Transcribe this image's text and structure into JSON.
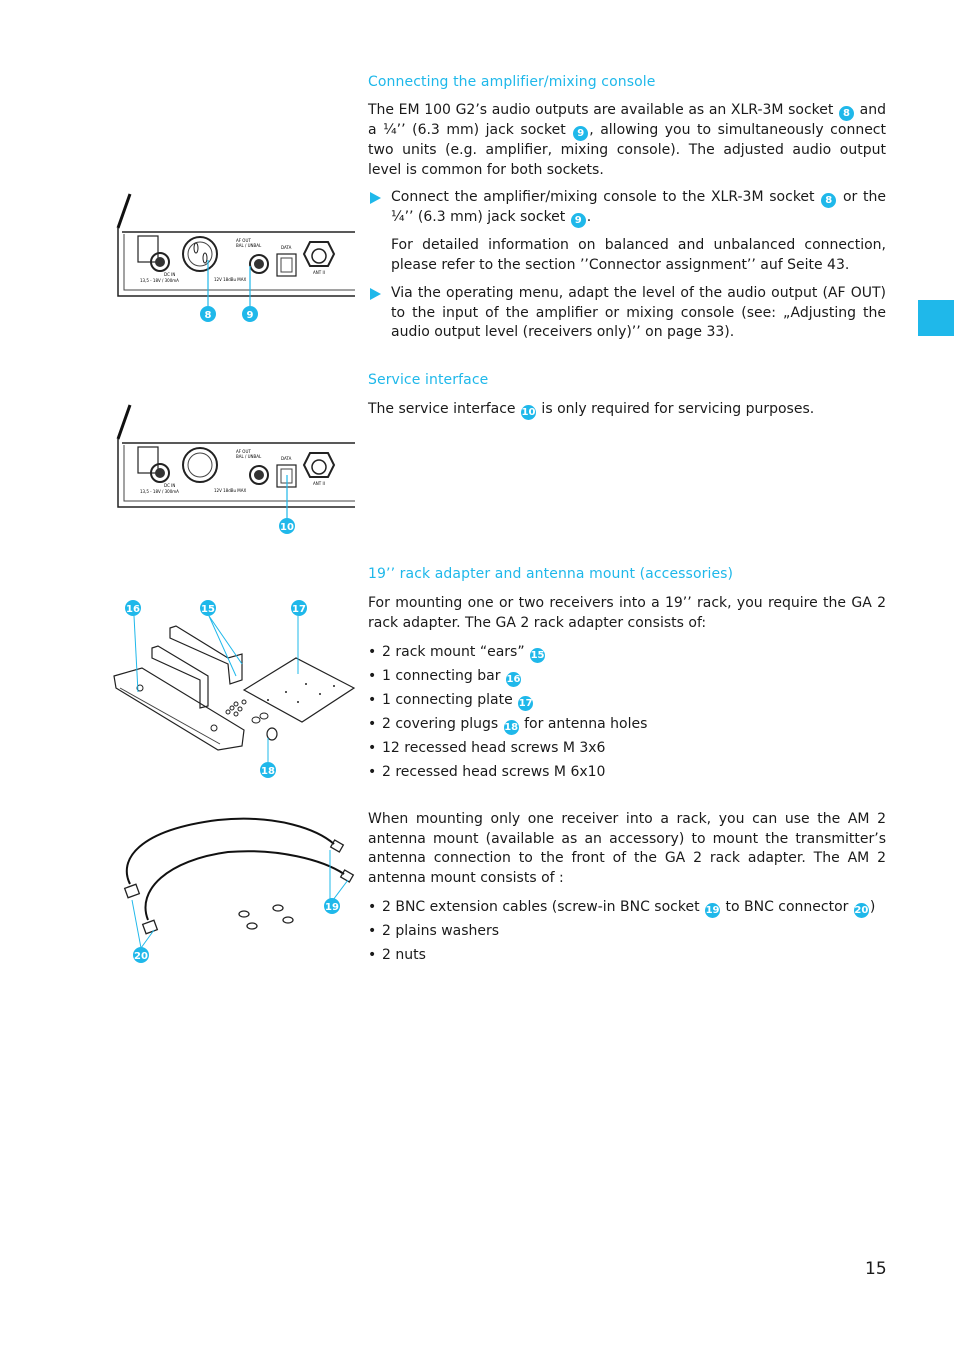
{
  "sections": {
    "amplifier": {
      "heading": "Connecting the amplifier/mixing console",
      "intro_parts": [
        "The EM 100 G2’s audio outputs are available as an XLR-3M socket ",
        "8",
        " and a ¼’’ (6.3 mm) jack socket ",
        "9",
        ", allowing you to simultaneously connect two units (e.g. amplifier, mixing console). The adjusted audio output level is common for both sockets."
      ],
      "step1_parts": [
        "Connect the amplifier/mixing console to the XLR-3M socket ",
        "8",
        " or the ¼’’ (6.3 mm) jack socket ",
        "9",
        "."
      ],
      "step1_note": "For detailed information on balanced and unbalanced connection, please refer to the section ’’Connector assignment’’ auf Seite 43.",
      "step2": "Via the operating menu, adapt the level of the audio output (AF OUT) to the input of the amplifier or mixing console (see: „Adjusting the audio output level (receivers only)’’ on page 33).",
      "figure_callouts": [
        "8",
        "9"
      ]
    },
    "service": {
      "heading": "Service interface",
      "text_parts": [
        "The service interface ",
        "10",
        " is only required for servicing purposes."
      ],
      "figure_callouts": [
        "10"
      ]
    },
    "rack": {
      "heading": "19’’ rack adapter and antenna mount (accessories)",
      "intro": "For mounting one or two receivers into a 19’’ rack, you require the GA 2 rack adapter. The GA 2 rack adapter consists of:",
      "items": [
        {
          "text": "2 rack mount “ears”",
          "ref": "15",
          "after": ""
        },
        {
          "text": "1 connecting bar",
          "ref": "16",
          "after": ""
        },
        {
          "text": "1 connecting plate",
          "ref": "17",
          "after": ""
        },
        {
          "text": "2 covering plugs",
          "ref": "18",
          "after": " for antenna holes"
        },
        {
          "text": "12 recessed head screws M 3x6",
          "ref": "",
          "after": ""
        },
        {
          "text": "2 recessed head screws M 6x10",
          "ref": "",
          "after": ""
        }
      ],
      "figure_callouts": [
        "16",
        "15",
        "17",
        "18"
      ]
    },
    "antenna": {
      "intro": "When mounting only one receiver into a rack, you can use the AM 2 antenna mount (available as an accessory) to mount the transmitter’s antenna connection to the front of the GA 2 rack adapter. The AM 2 antenna mount consists of :",
      "items": [
        {
          "text": "2 BNC extension cables (screw-in BNC socket ",
          "ref": "19",
          "mid": " to BNC connector ",
          "ref2": "20",
          "after": ")"
        },
        {
          "text": "2 plains washers",
          "ref": "",
          "mid": "",
          "ref2": "",
          "after": ""
        },
        {
          "text": "2 nuts",
          "ref": "",
          "mid": "",
          "ref2": "",
          "after": ""
        }
      ],
      "figure_callouts": [
        "19",
        "20"
      ]
    }
  },
  "device_labels": {
    "af_out": "AF OUT",
    "bal_unbal": "BAL / UNBAL",
    "data": "DATA",
    "ant": "ANT II",
    "dc_in": "DC IN",
    "dc_spec": "13,5 - 18V / 300mA",
    "level": "12V 18dBu MAX"
  },
  "page_number": "15",
  "colors": {
    "accent": "#1fb8ea",
    "text": "#1a1a1a"
  }
}
